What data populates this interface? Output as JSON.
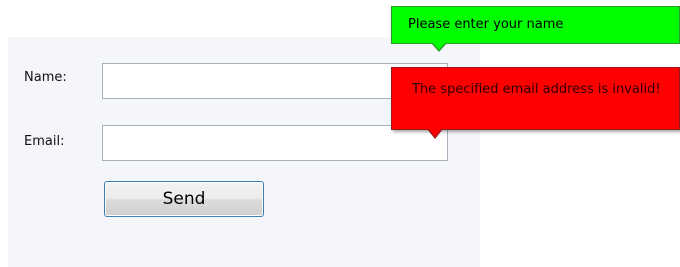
{
  "form": {
    "name_label": "Name:",
    "email_label": "Email:",
    "name_value": "",
    "email_value": "",
    "send_label": "Send"
  },
  "tooltips": {
    "name_error": "Please enter your name",
    "email_error": "The specified email address is invalid!"
  },
  "colors": {
    "name_tooltip_bg": "#00ff00",
    "email_tooltip_bg": "#ff0000",
    "panel_bg": "#f4f6fa",
    "button_border": "#3c7fb1"
  }
}
